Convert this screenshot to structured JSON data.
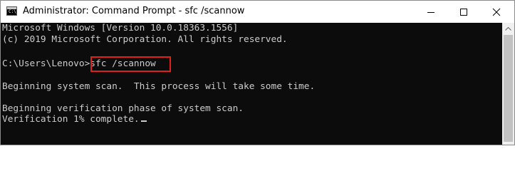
{
  "window": {
    "title": "Administrator: Command Prompt - sfc  /scannow",
    "icon": "cmd-icon",
    "icon_glyph": "C:\\",
    "controls": {
      "minimize_icon": "minimize-icon",
      "maximize_icon": "maximize-icon",
      "close_icon": "close-icon"
    }
  },
  "console": {
    "background": "#0c0c0c",
    "text_color": "#cccccc",
    "lines": [
      "Microsoft Windows [Version 10.0.18363.1556]",
      "(c) 2019 Microsoft Corporation. All rights reserved.",
      "",
      "C:\\Users\\Lenovo>",
      "",
      "Beginning system scan.  This process will take some time.",
      "",
      "Beginning verification phase of system scan.",
      "Verification 1% complete."
    ],
    "command": "sfc /scannow",
    "highlight_color": "#e0201a"
  },
  "scrollbar": {
    "up_icon": "chevron-up-icon"
  }
}
